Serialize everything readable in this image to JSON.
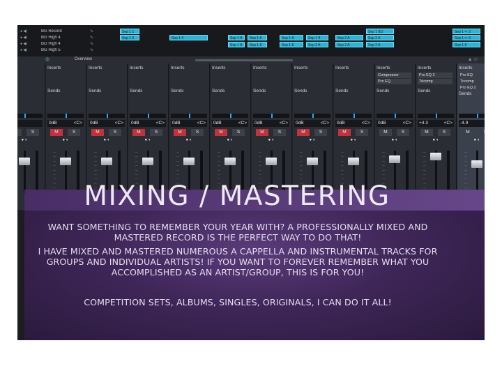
{
  "arranger": {
    "tracks": [
      {
        "name": "BG Record"
      },
      {
        "name": "BG High 4"
      },
      {
        "name": "BG High 4"
      },
      {
        "name": "BG High 5"
      }
    ],
    "clips": [
      "Sep 1 1",
      "Sep 1 0",
      "Sep 1 0",
      "Sep 1 8",
      "Sep 1 8",
      "Sep 1 8",
      "Sep 1 8",
      "Sep 1 8",
      "Sep 1 8",
      "Sep 1 8",
      "Sep 2 A",
      "Sep 2 A",
      "Sep 2 A",
      "Sep 2 A",
      "Sep 2 A",
      "Sep 1 =: 3",
      "Sep 1 =: 3",
      "Sep 1 8",
      "Sep 1 8(2"
    ]
  },
  "overview": {
    "label": "Overview"
  },
  "mixer": {
    "strips": [
      {
        "inserts": "erts",
        "sends": "nds",
        "gain": "",
        "pan": "",
        "num": "",
        "mute_on": false,
        "plugins": []
      },
      {
        "inserts": "Inserts",
        "sends": "Sends",
        "gain": "0dB",
        "pan": "<C>",
        "num": "",
        "mute_on": true,
        "plugins": []
      },
      {
        "inserts": "Inserts",
        "sends": "Sends",
        "gain": "0dB",
        "pan": "<C>",
        "num": "",
        "mute_on": true,
        "plugins": []
      },
      {
        "inserts": "Inserts",
        "sends": "Sends",
        "gain": "0dB",
        "pan": "<C>",
        "num": "4",
        "mute_on": true,
        "plugins": []
      },
      {
        "inserts": "Inserts",
        "sends": "Sends",
        "gain": "0dB",
        "pan": "<C>",
        "num": "5",
        "mute_on": true,
        "plugins": []
      },
      {
        "inserts": "Inserts",
        "sends": "Sends",
        "gain": "0dB",
        "pan": "<C>",
        "num": "6",
        "mute_on": true,
        "plugins": []
      },
      {
        "inserts": "Inserts",
        "sends": "Sends",
        "gain": "0dB",
        "pan": "<C>",
        "num": "7",
        "mute_on": true,
        "plugins": []
      },
      {
        "inserts": "Inserts",
        "sends": "Sends",
        "gain": "0dB",
        "pan": "<C>",
        "num": "8",
        "mute_on": true,
        "plugins": []
      },
      {
        "inserts": "Inserts",
        "sends": "Sends",
        "gain": "0dB",
        "pan": "<C>",
        "num": "9",
        "mute_on": true,
        "plugins": []
      },
      {
        "inserts": "Inserts",
        "sends": "Sends",
        "gain": "0dB",
        "pan": "<C>",
        "num": "10",
        "mute_on": false,
        "plugins": [
          "Compressor",
          "Pro EQ"
        ]
      },
      {
        "inserts": "Inserts",
        "sends": "Sends",
        "gain": "+4.3",
        "pan": "<C>",
        "num": "11",
        "mute_on": false,
        "plugins": [
          "Pro EQ 2",
          "Tricomp"
        ]
      },
      {
        "inserts": "Inserts",
        "sends": "Sends",
        "gain": "-4.9",
        "pan": "<C>",
        "num": "12",
        "mute_on": false,
        "plugins": [
          "Pro EQ",
          "Tricomp",
          "Pro EQ 2"
        ]
      },
      {
        "inserts": "Inserts",
        "sends": "Sends",
        "gain": "+1.6",
        "pan": "L",
        "num": "",
        "mute_on": false,
        "plugins": [
          "Pro EQ",
          "Tricomp",
          "Mono"
        ]
      }
    ],
    "labels": {
      "mute": "M",
      "solo": "S"
    }
  },
  "banner": {
    "title": "MIXING / MASTERING",
    "paragraph1": "WANT SOMETHING TO REMEMBER YOUR YEAR WITH? A PROFESSIONALLY MIXED AND MASTERED RECORD IS THE PERFECT WAY TO DO THAT!",
    "paragraph2": "I HAVE MIXED AND MASTERED NUMEROUS A CAPPELLA AND INSTRUMENTAL TRACKS FOR GROUPS AND INDIVIDUAL ARTISTS! IF YOU WANT TO FOREVER REMEMBER WHAT YOU ACCOMPLISHED AS AN ARTIST/GROUP, THIS IS FOR YOU!",
    "paragraph3": "COMPETITION SETS, ALBUMS, SINGLES, ORIGINALS, I CAN DO IT ALL!"
  },
  "colors": {
    "clip": "#2bb4d6",
    "mute_active": "#c0333c",
    "meter": "#2fa8ff",
    "banner_purple": "#4a2e68",
    "banner_text": "#ede9f2"
  }
}
